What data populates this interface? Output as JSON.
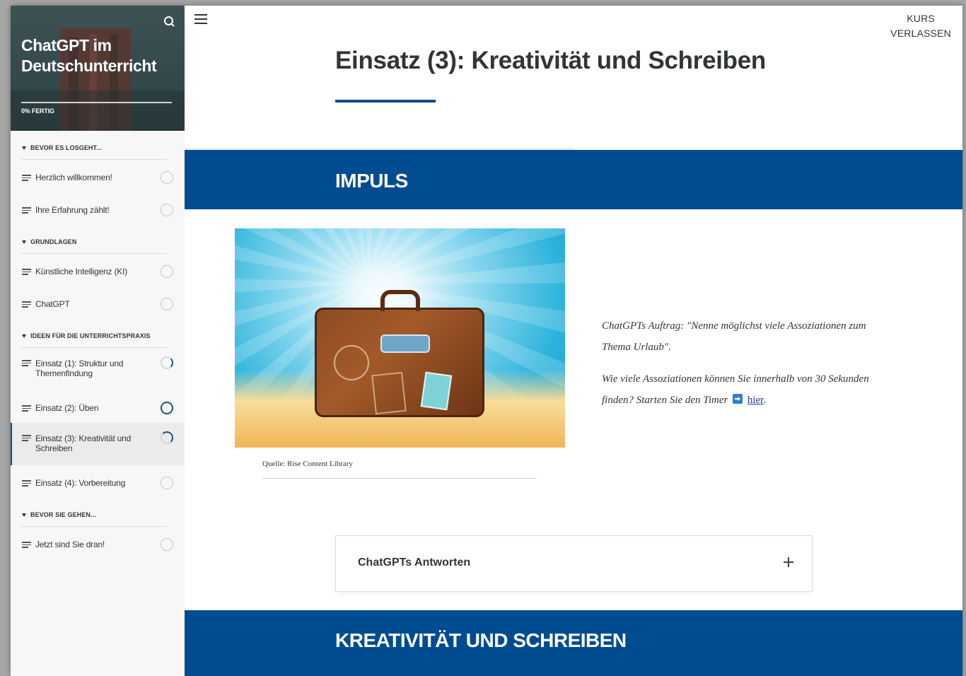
{
  "course": {
    "title": "ChatGPT im Deutschunterricht",
    "progress_text": "0% FERTIG"
  },
  "sidebar": {
    "sections": [
      {
        "title": "BEVOR ES LOSGEHT...",
        "lessons": [
          {
            "label": "Herzlich willkommen!",
            "status": "empty"
          },
          {
            "label": "Ihre Erfahrung zählt!",
            "status": "empty"
          }
        ]
      },
      {
        "title": "GRUNDLAGEN",
        "lessons": [
          {
            "label": "Künstliche Intelligenz (KI)",
            "status": "empty"
          },
          {
            "label": "ChatGPT",
            "status": "empty"
          }
        ]
      },
      {
        "title": "IDEEN FÜR DIE UNTERRICHTSPRAXIS",
        "lessons": [
          {
            "label": "Einsatz (1): Struktur und Themenfindung",
            "status": "partial"
          },
          {
            "label": "Einsatz (2): Üben",
            "status": "complete"
          },
          {
            "label": "Einsatz (3): Kreativität und Schreiben",
            "status": "partial",
            "active": true
          },
          {
            "label": "Einsatz (4): Vorbereitung",
            "status": "empty"
          }
        ]
      },
      {
        "title": "BEVOR SIE GEHEN...",
        "lessons": [
          {
            "label": "Jetzt sind Sie dran!",
            "status": "empty"
          }
        ]
      }
    ]
  },
  "header": {
    "exit_line1": "KURS",
    "exit_line2": "VERLASSEN"
  },
  "main": {
    "page_title": "Einsatz (3): Kreativität und Schreiben",
    "impulse_heading": "IMPULS",
    "image_caption": "Quelle: Rise Content Library",
    "impulse_text1": "ChatGPTs Auftrag: \"Nenne möglichst viele Assoziationen zum Thema Urlaub\".",
    "impulse_text2": "Wie viele Assoziationen können Sie innerhalb von 30 Sekunden finden? Starten Sie den Timer",
    "impulse_link": "hier",
    "accordion_title": "ChatGPTs Antworten",
    "section2_heading": "KREATIVITÄT UND SCHREIBEN"
  },
  "colors": {
    "accent": "#004c91",
    "link": "#1a3e8c"
  },
  "icons": [
    "search-icon",
    "menu-icon",
    "lesson-icon",
    "status-circle-icon",
    "arrow-right-icon",
    "plus-icon"
  ]
}
